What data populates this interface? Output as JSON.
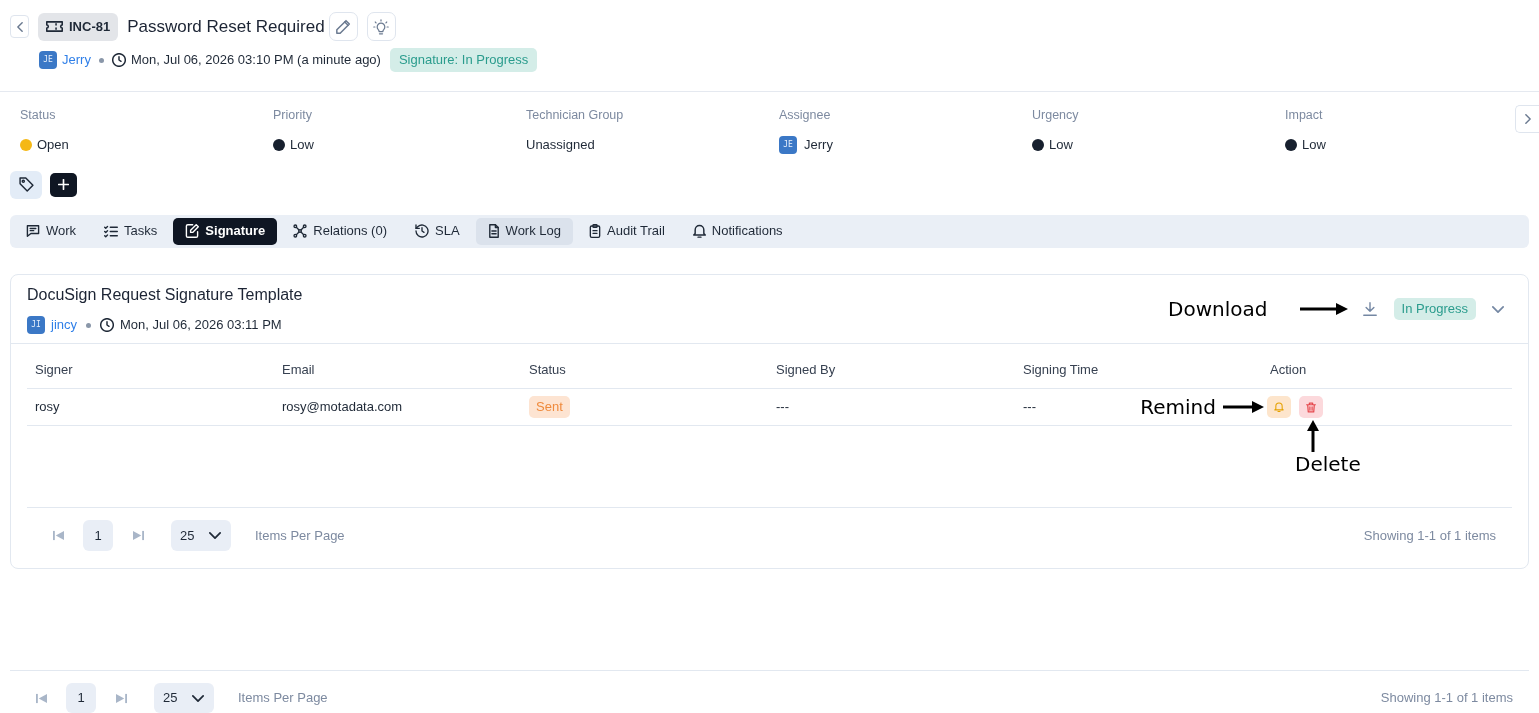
{
  "header": {
    "ticket_id": "INC-81",
    "title": "Password Reset Required",
    "requester": {
      "initials": "JE",
      "name": "Jerry"
    },
    "created": "Mon, Jul 06, 2026 03:10 PM (a minute ago)",
    "signature_status": "Signature: In Progress"
  },
  "fields": [
    {
      "label": "Status",
      "kind": "dot",
      "value": "Open",
      "color": "#f5b815"
    },
    {
      "label": "Priority",
      "kind": "dot",
      "value": "Low",
      "color": "#17202e"
    },
    {
      "label": "Technician Group",
      "kind": "text",
      "value": "Unassigned"
    },
    {
      "label": "Assignee",
      "kind": "avatar",
      "initials": "JE",
      "value": "Jerry"
    },
    {
      "label": "Urgency",
      "kind": "dot",
      "value": "Low",
      "color": "#17202e"
    },
    {
      "label": "Impact",
      "kind": "dot",
      "value": "Low",
      "color": "#17202e"
    }
  ],
  "tabs": [
    {
      "label": "Work",
      "selected": false,
      "hovered": false
    },
    {
      "label": "Tasks",
      "selected": false,
      "hovered": false
    },
    {
      "label": "Signature",
      "selected": true,
      "hovered": false
    },
    {
      "label": "Relations (0)",
      "selected": false,
      "hovered": false
    },
    {
      "label": "SLA",
      "selected": false,
      "hovered": false
    },
    {
      "label": "Work Log",
      "selected": false,
      "hovered": true
    },
    {
      "label": "Audit Trail",
      "selected": false,
      "hovered": false
    },
    {
      "label": "Notifications",
      "selected": false,
      "hovered": false
    }
  ],
  "signature_request": {
    "title": "DocuSign Request Signature Template",
    "author": {
      "initials": "JI",
      "name": "jincy"
    },
    "time": "Mon, Jul 06, 2026 03:11 PM",
    "download_callout": "Download",
    "status": "In Progress",
    "table": {
      "columns": [
        "Signer",
        "Email",
        "Status",
        "Signed By",
        "Signing Time",
        "Action"
      ],
      "rows": [
        {
          "signer": "rosy",
          "email": "rosy@motadata.com",
          "status": "Sent",
          "signed_by": "---",
          "signing_time": "---",
          "remind_callout": "Remind",
          "delete_callout": "Delete"
        }
      ]
    },
    "pagination": {
      "page": "1",
      "page_size": "25",
      "page_size_label": "Items Per Page",
      "summary": "Showing 1-1 of 1 items"
    }
  },
  "pagination": {
    "page": "1",
    "page_size": "25",
    "page_size_label": "Items Per Page",
    "summary": "Showing 1-1 of 1 items"
  }
}
